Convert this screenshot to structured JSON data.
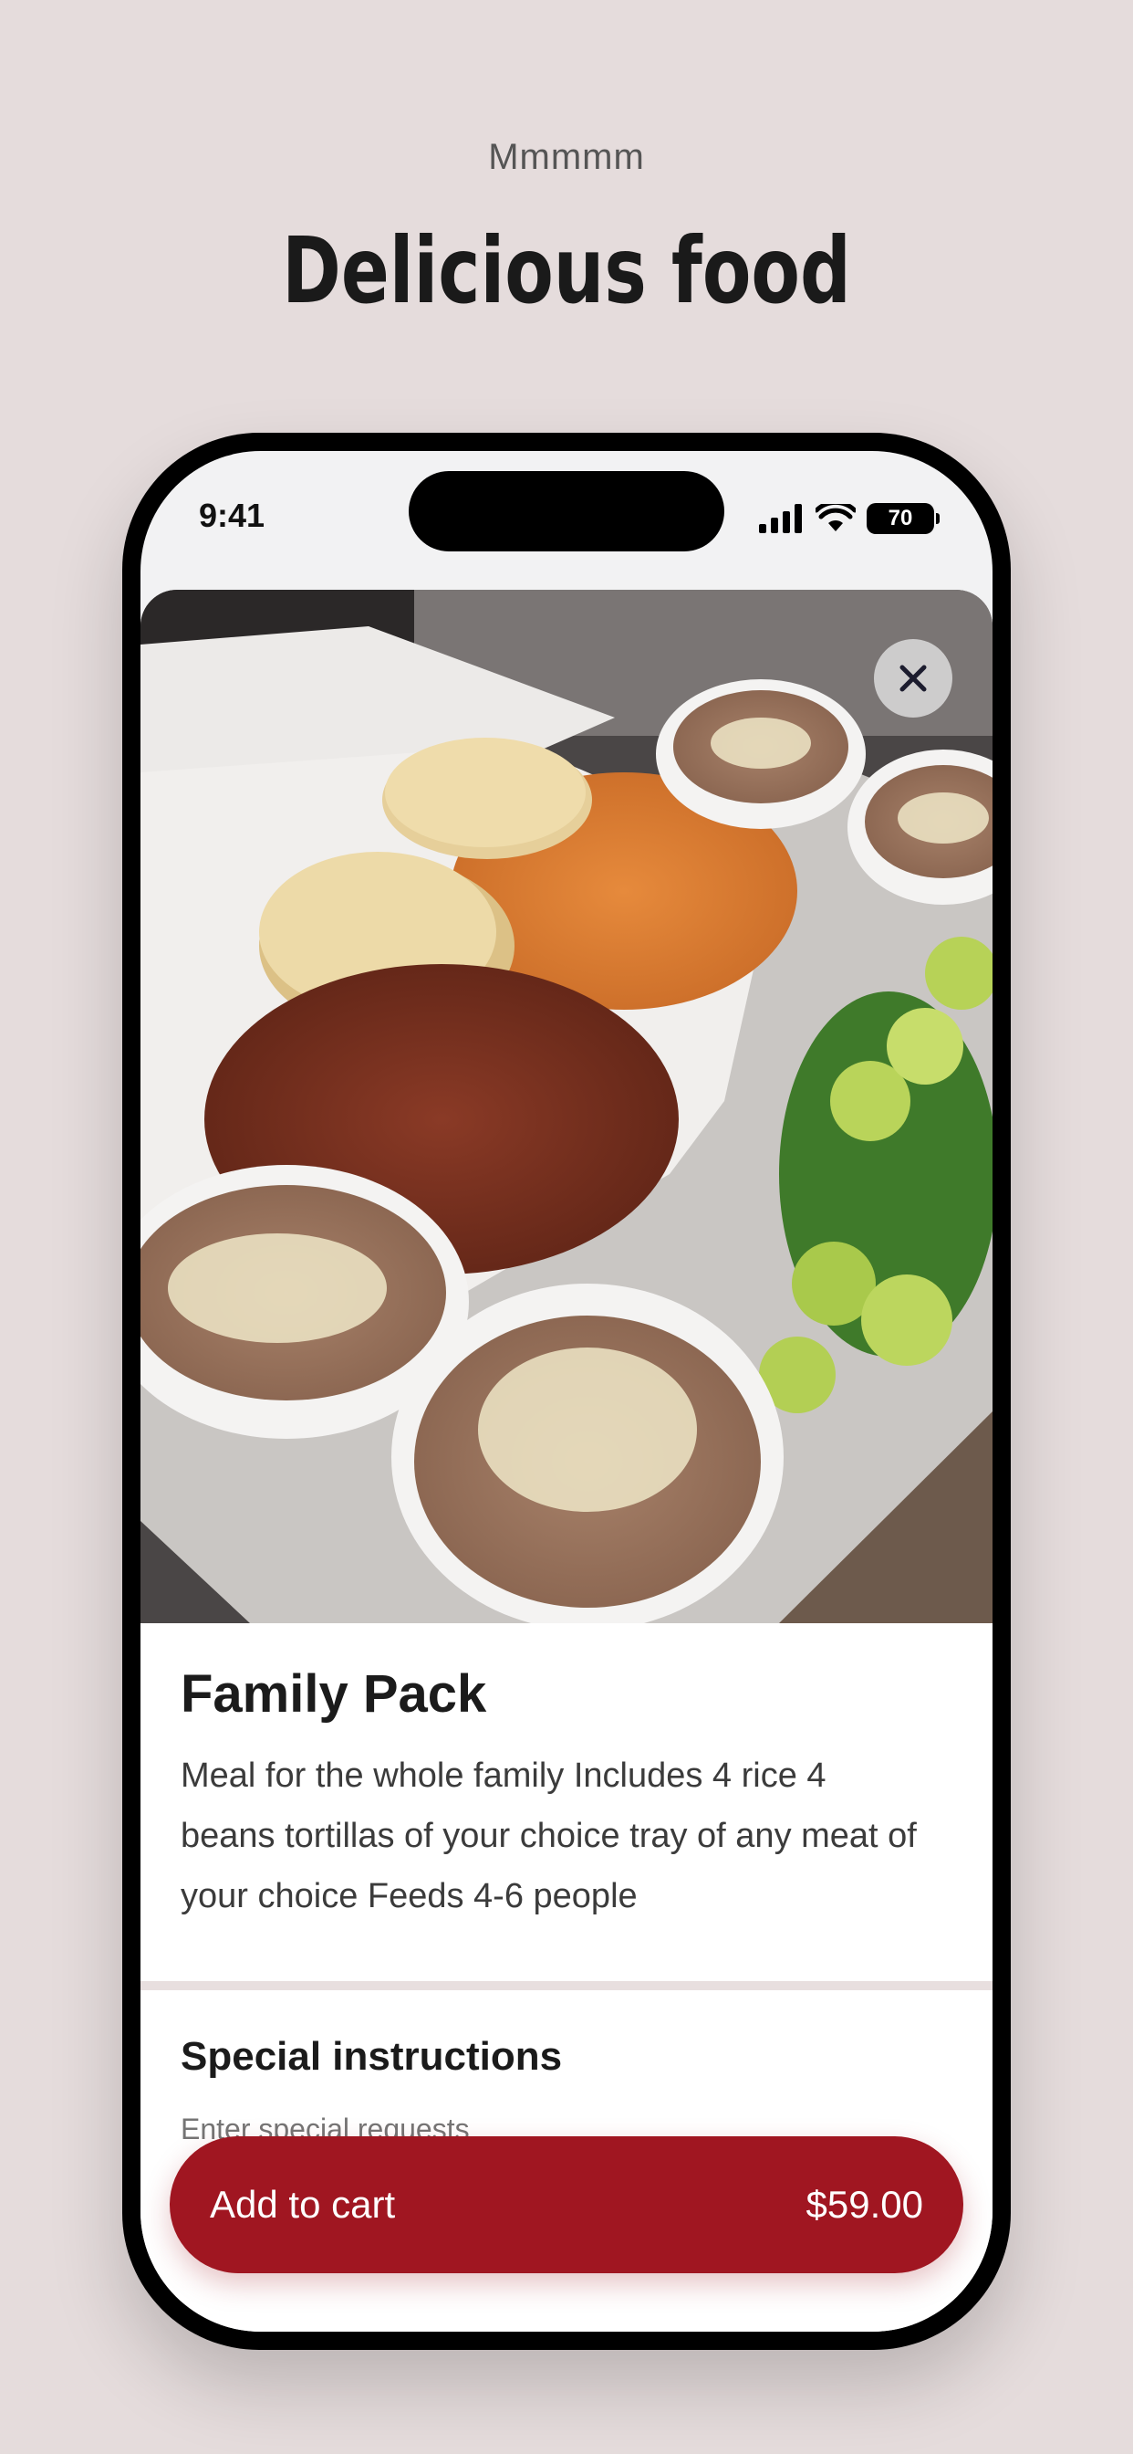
{
  "page": {
    "eyebrow": "Mmmmm",
    "headline": "Delicious food"
  },
  "status_bar": {
    "time": "9:41",
    "battery": "70"
  },
  "item": {
    "title": "Family Pack",
    "description": "Meal for the whole family Includes 4 rice 4 beans tortillas of your choice tray of any meat of your choice Feeds 4-6 people"
  },
  "instructions": {
    "title": "Special instructions",
    "placeholder": "Enter special requests"
  },
  "cart_button": {
    "label": "Add to cart",
    "price": "$59.00"
  },
  "colors": {
    "background": "#e5dcdc",
    "accent": "#a01621"
  }
}
